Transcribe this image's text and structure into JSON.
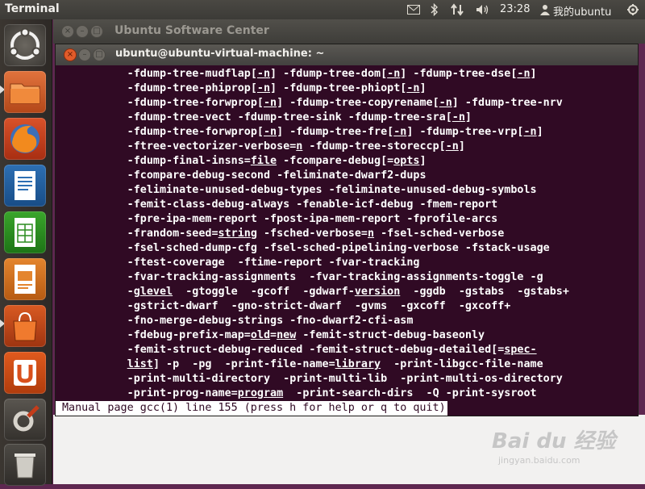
{
  "panel": {
    "app_title": "Terminal",
    "clock": "23:28",
    "user": "我的ubuntu"
  },
  "launcher": {
    "items": [
      {
        "name": "Dash Home",
        "icon": "ubuntu-logo-icon"
      },
      {
        "name": "Files",
        "icon": "folder-icon"
      },
      {
        "name": "Firefox",
        "icon": "firefox-icon"
      },
      {
        "name": "Writer",
        "icon": "writer-document-icon"
      },
      {
        "name": "Calc",
        "icon": "calc-spreadsheet-icon"
      },
      {
        "name": "Impress",
        "icon": "impress-presentation-icon"
      },
      {
        "name": "Software Center",
        "icon": "shopping-bag-icon"
      },
      {
        "name": "Ubuntu One",
        "icon": "ubuntu-one-icon"
      },
      {
        "name": "System Settings",
        "icon": "settings-tools-icon"
      },
      {
        "name": "Trash",
        "icon": "trash-icon"
      }
    ]
  },
  "background_window": {
    "title": "Ubuntu Software Center"
  },
  "terminal": {
    "title": "ubuntu@ubuntu-virtual-machine: ~",
    "lines": [
      [
        {
          "t": "           -fdump-tree-mudflap["
        },
        {
          "t": "-n",
          "u": true
        },
        {
          "t": "] -fdump-tree-dom["
        },
        {
          "t": "-n",
          "u": true
        },
        {
          "t": "] -fdump-tree-dse["
        },
        {
          "t": "-n",
          "u": true
        },
        {
          "t": "]"
        }
      ],
      [
        {
          "t": "           -fdump-tree-phiprop["
        },
        {
          "t": "-n",
          "u": true
        },
        {
          "t": "] -fdump-tree-phiopt["
        },
        {
          "t": "-n",
          "u": true
        },
        {
          "t": "]"
        }
      ],
      [
        {
          "t": "           -fdump-tree-forwprop["
        },
        {
          "t": "-n",
          "u": true
        },
        {
          "t": "] -fdump-tree-copyrename["
        },
        {
          "t": "-n",
          "u": true
        },
        {
          "t": "] -fdump-tree-nrv"
        }
      ],
      [
        {
          "t": "           -fdump-tree-vect -fdump-tree-sink -fdump-tree-sra["
        },
        {
          "t": "-n",
          "u": true
        },
        {
          "t": "]"
        }
      ],
      [
        {
          "t": "           -fdump-tree-forwprop["
        },
        {
          "t": "-n",
          "u": true
        },
        {
          "t": "] -fdump-tree-fre["
        },
        {
          "t": "-n",
          "u": true
        },
        {
          "t": "] -fdump-tree-vrp["
        },
        {
          "t": "-n",
          "u": true
        },
        {
          "t": "]"
        }
      ],
      [
        {
          "t": "           -ftree-vectorizer-verbose="
        },
        {
          "t": "n",
          "u": true
        },
        {
          "t": " -fdump-tree-storeccp["
        },
        {
          "t": "-n",
          "u": true
        },
        {
          "t": "]"
        }
      ],
      [
        {
          "t": "           -fdump-final-insns="
        },
        {
          "t": "file",
          "u": true
        },
        {
          "t": " -fcompare-debug[="
        },
        {
          "t": "opts",
          "u": true
        },
        {
          "t": "]"
        }
      ],
      [
        {
          "t": "           -fcompare-debug-second -feliminate-dwarf2-dups"
        }
      ],
      [
        {
          "t": "           -feliminate-unused-debug-types -feliminate-unused-debug-symbols"
        }
      ],
      [
        {
          "t": "           -femit-class-debug-always -fenable-icf-debug -fmem-report"
        }
      ],
      [
        {
          "t": "           -fpre-ipa-mem-report -fpost-ipa-mem-report -fprofile-arcs"
        }
      ],
      [
        {
          "t": "           -frandom-seed="
        },
        {
          "t": "string",
          "u": true
        },
        {
          "t": " -fsched-verbose="
        },
        {
          "t": "n",
          "u": true
        },
        {
          "t": " -fsel-sched-verbose"
        }
      ],
      [
        {
          "t": "           -fsel-sched-dump-cfg -fsel-sched-pipelining-verbose -fstack-usage"
        }
      ],
      [
        {
          "t": "           -ftest-coverage  -ftime-report -fvar-tracking"
        }
      ],
      [
        {
          "t": "           -fvar-tracking-assignments  -fvar-tracking-assignments-toggle -g"
        }
      ],
      [
        {
          "t": "           -g"
        },
        {
          "t": "level",
          "u": true
        },
        {
          "t": "  -gtoggle  -gcoff  -gdwarf-"
        },
        {
          "t": "version",
          "u": true
        },
        {
          "t": "  -ggdb  -gstabs  -gstabs+"
        }
      ],
      [
        {
          "t": "           -gstrict-dwarf  -gno-strict-dwarf  -gvms  -gxcoff  -gxcoff+"
        }
      ],
      [
        {
          "t": "           -fno-merge-debug-strings -fno-dwarf2-cfi-asm"
        }
      ],
      [
        {
          "t": "           -fdebug-prefix-map="
        },
        {
          "t": "old",
          "u": true
        },
        {
          "t": "="
        },
        {
          "t": "new",
          "u": true
        },
        {
          "t": " -femit-struct-debug-baseonly"
        }
      ],
      [
        {
          "t": "           -femit-struct-debug-reduced -femit-struct-debug-detailed[="
        },
        {
          "t": "spec-",
          "u": true
        }
      ],
      [
        {
          "t": "           "
        },
        {
          "t": "list",
          "u": true
        },
        {
          "t": "] -p  -pg  -print-file-name="
        },
        {
          "t": "library",
          "u": true
        },
        {
          "t": "  -print-libgcc-file-name"
        }
      ],
      [
        {
          "t": "           -print-multi-directory  -print-multi-lib  -print-multi-os-directory"
        }
      ],
      [
        {
          "t": "           -print-prog-name="
        },
        {
          "t": "program",
          "u": true
        },
        {
          "t": "  -print-search-dirs  -Q -print-sysroot"
        }
      ]
    ],
    "status_line": "Manual page gcc(1) line 155 (press h for help or q to quit)"
  },
  "watermark": {
    "main": "Bai du 经验",
    "sub": "jingyan.baidu.com"
  }
}
